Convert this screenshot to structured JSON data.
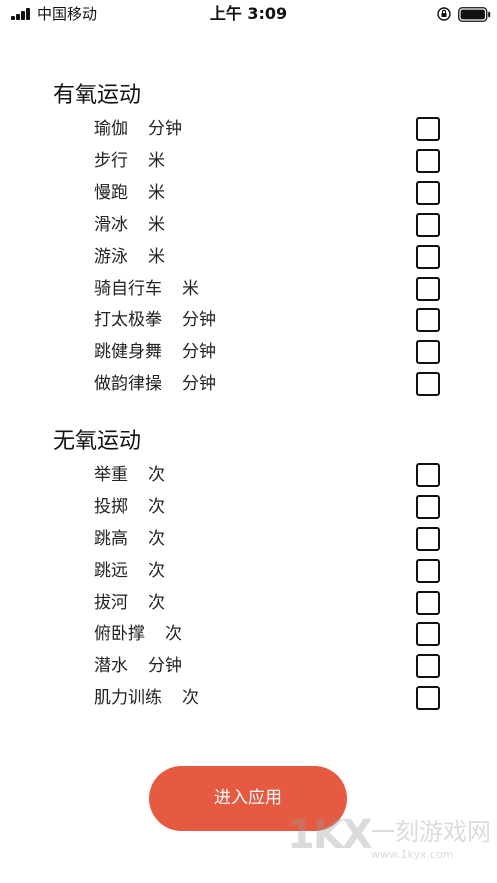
{
  "status_bar": {
    "carrier": "中国移动",
    "time": "上午 3:09"
  },
  "sections": [
    {
      "title": "有氧运动",
      "items": [
        {
          "name": "瑜伽",
          "unit": "分钟"
        },
        {
          "name": "步行",
          "unit": "米"
        },
        {
          "name": "慢跑",
          "unit": "米"
        },
        {
          "name": "滑冰",
          "unit": "米"
        },
        {
          "name": "游泳",
          "unit": "米"
        },
        {
          "name": "骑自行车",
          "unit": "米"
        },
        {
          "name": "打太极拳",
          "unit": "分钟"
        },
        {
          "name": "跳健身舞",
          "unit": "分钟"
        },
        {
          "name": "做韵律操",
          "unit": "分钟"
        }
      ]
    },
    {
      "title": "无氧运动",
      "items": [
        {
          "name": "举重",
          "unit": "次"
        },
        {
          "name": "投掷",
          "unit": "次"
        },
        {
          "name": "跳高",
          "unit": "次"
        },
        {
          "name": "跳远",
          "unit": "次"
        },
        {
          "name": "拔河",
          "unit": "次"
        },
        {
          "name": "俯卧撑",
          "unit": "次"
        },
        {
          "name": "潜水",
          "unit": "分钟"
        },
        {
          "name": "肌力训练",
          "unit": "次"
        }
      ]
    }
  ],
  "enter_button": {
    "label": "进入应用"
  },
  "watermark": {
    "logo": "1KX",
    "name": "一刻游戏网",
    "url": "www.1kyx.com"
  },
  "colors": {
    "accent": "#e65a42",
    "text": "#111111",
    "background": "#ffffff"
  }
}
